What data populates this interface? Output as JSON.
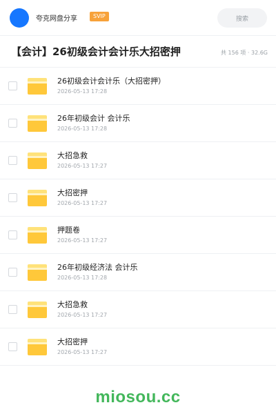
{
  "header": {
    "username": "夸克网盘分享",
    "badge": "SVIP",
    "search_placeholder": "搜索"
  },
  "folder": {
    "title": "【会计】26初级会计会计乐大招密押",
    "meta": "共 156 项 · 32.6G"
  },
  "files": [
    {
      "name": "26初级会计会计乐（大招密押）",
      "date": "2026-05-13 17:28"
    },
    {
      "name": "26年初级会计  会计乐",
      "date": "2026-05-13 17:28"
    },
    {
      "name": "大招急救",
      "date": "2026-05-13 17:27"
    },
    {
      "name": "大招密押",
      "date": "2026-05-13 17:27"
    },
    {
      "name": "押题卷",
      "date": "2026-05-13 17:27"
    },
    {
      "name": "26年初级经济法  会计乐",
      "date": "2026-05-13 17:28"
    },
    {
      "name": "大招急救",
      "date": "2026-05-13 17:27"
    },
    {
      "name": "大招密押",
      "date": "2026-05-13 17:27"
    }
  ],
  "watermark": "miosou.cc",
  "colors": {
    "accent": "#1677ff",
    "badge": "#f7a23a",
    "folder": "#ffc83a",
    "watermark": "#43b75b"
  }
}
